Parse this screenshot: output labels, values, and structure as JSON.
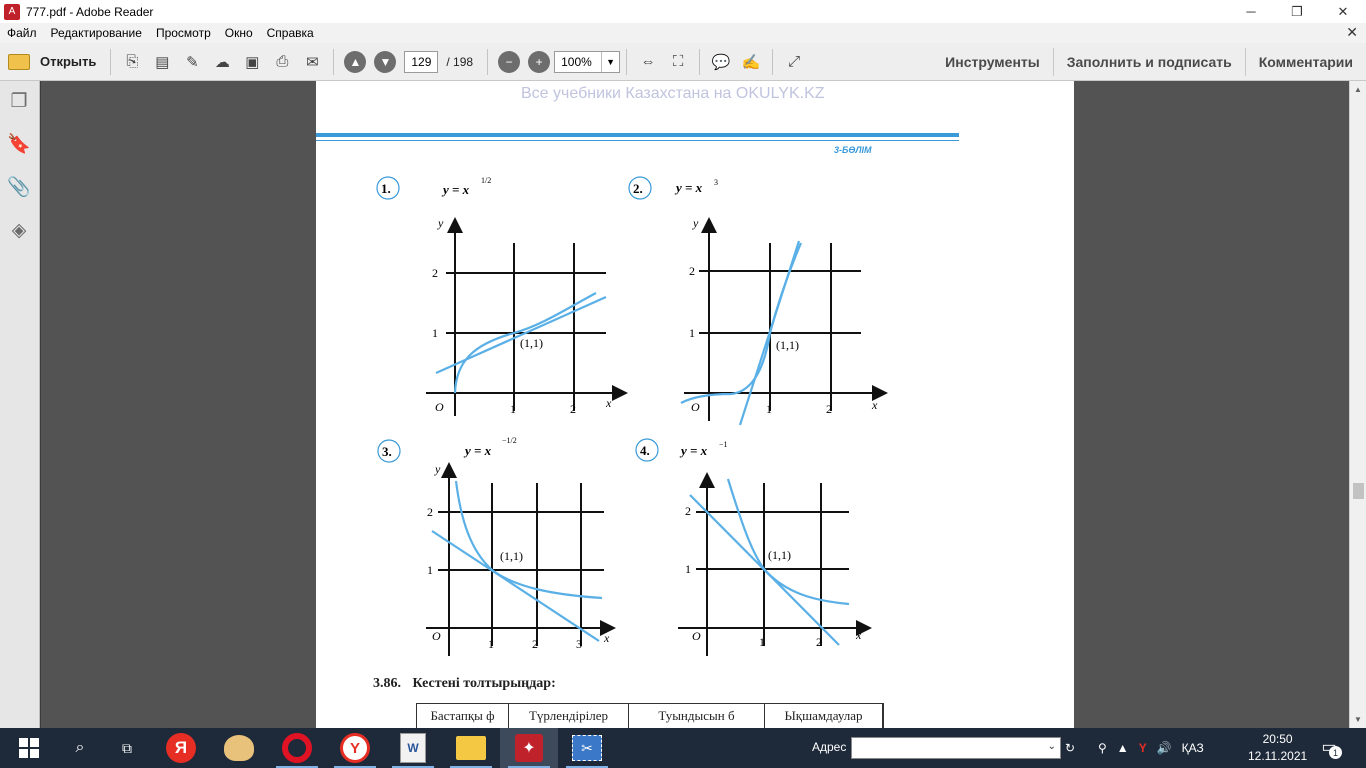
{
  "window": {
    "title": "777.pdf - Adobe Reader",
    "minimize": "─",
    "restore": "❐",
    "close": "✕",
    "app_icon": "acrobat-icon"
  },
  "menu": {
    "items": [
      "Файл",
      "Редактирование",
      "Просмотр",
      "Окно",
      "Справка"
    ],
    "close_doc": "✕"
  },
  "toolbar": {
    "open_label": "Открыть",
    "page_current": "129",
    "page_total": "/ 198",
    "zoom": "100%",
    "zoom_minus": "−",
    "zoom_plus": "+",
    "prev_page": "▲",
    "next_page": "▼",
    "tools_label": "Инструменты",
    "fill_sign_label": "Заполнить и подписать",
    "comment_label": "Комментарии"
  },
  "sidebar": {
    "icons": [
      "pages-icon",
      "bookmark-icon",
      "attachment-icon",
      "layers-icon"
    ]
  },
  "document": {
    "watermark": "Все учебники Казахстана на OKULYK.KZ",
    "section": "3-БӨЛІМ",
    "graphs": [
      {
        "number": "1.",
        "formula_base": "y = x",
        "formula_exp": "1/2"
      },
      {
        "number": "2.",
        "formula_base": "y = x",
        "formula_exp": "3"
      },
      {
        "number": "3.",
        "formula_base": "y = x",
        "formula_exp": "−1/2"
      },
      {
        "number": "4.",
        "formula_base": "y = x",
        "formula_exp": "−1"
      }
    ],
    "point_label": "(1,1)",
    "axis_x": "x",
    "axis_y": "y",
    "origin": "O",
    "tick_1": "1",
    "tick_2": "2",
    "tick_3": "3",
    "exercise_number": "3.86.",
    "exercise_text": "Кестені толтырыңдар:",
    "table_headers": [
      "Бастапқы ф",
      "Түрлендірілер",
      "Туындысын б",
      "Ықшамдаулар"
    ]
  },
  "taskbar": {
    "address_label": "Адрес",
    "address_value": "",
    "clock_time": "20:50",
    "clock_date": "12.11.2021",
    "lang": "ҚАЗ",
    "notification_count": "1",
    "apps": [
      "start-button",
      "search-button",
      "task-view-button",
      "yandex-app",
      "paint-app",
      "opera-app",
      "yandex-browser-app",
      "word-app",
      "explorer-app",
      "adobe-reader-app",
      "snipping-tool-app"
    ]
  }
}
